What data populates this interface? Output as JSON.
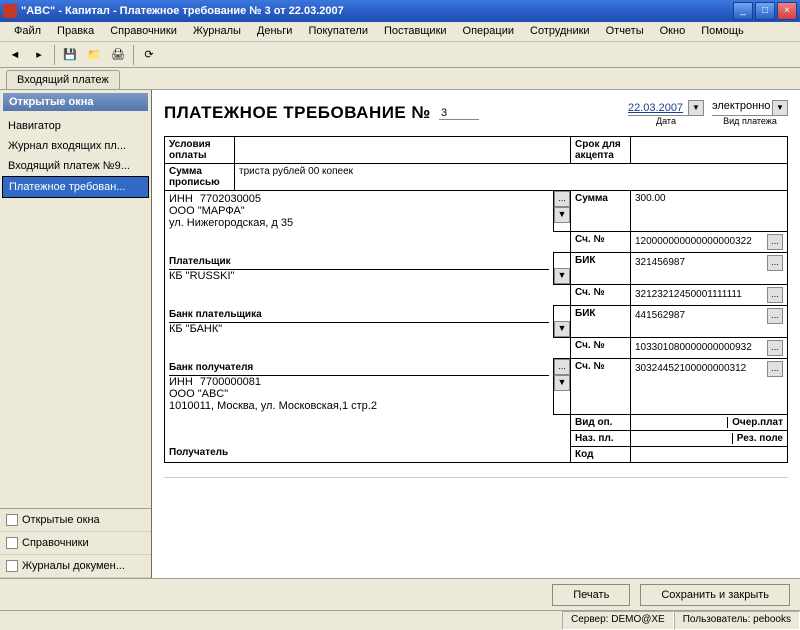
{
  "window": {
    "title": "\"ABC\" - Капитал - Платежное требование № 3 от 22.03.2007"
  },
  "menu": [
    "Файл",
    "Правка",
    "Справочники",
    "Журналы",
    "Деньги",
    "Покупатели",
    "Поставщики",
    "Операции",
    "Сотрудники",
    "Отчеты",
    "Окно",
    "Помощь"
  ],
  "tab": "Входящий платеж",
  "sidebar": {
    "header": "Открытые окна",
    "items": [
      "Навигатор",
      "Журнал входящих пл...",
      "Входящий платеж №9...",
      "Платежное требован..."
    ],
    "btns": [
      "Открытые окна",
      "Справочники",
      "Журналы докумен..."
    ]
  },
  "doc": {
    "title": "ПЛАТЕЖНОЕ ТРЕБОВАНИЕ №",
    "num": "3",
    "date": "22.03.2007",
    "datelbl": "Дата",
    "paytype": "электронно",
    "paytypelbl": "Вид платежа",
    "cond_lbl": "Условия оплаты",
    "accept_lbl": "Срок для акцепта",
    "sum_words_lbl": "Сумма прописью",
    "sum_words": "триста рублей 00 копеек",
    "inn1_lbl": "ИНН",
    "inn1": "7702030005",
    "org1": "ООО \"МАРФА\"",
    "addr1": "ул. Нижегородская, д 35",
    "sum_lbl": "Сумма",
    "sum": "300.00",
    "sch_lbl": "Сч. №",
    "sch1": "120000000000000000322",
    "payer_lbl": "Плательщик",
    "kb1": "КБ \"RUSSKI\"",
    "bik_lbl": "БИК",
    "bik1": "321456987",
    "sch2": "32123212450001111111",
    "bank_payer_lbl": "Банк плательщика",
    "kb2": "КБ \"БАНК\"",
    "bik2": "441562987",
    "sch3": "103301080000000000932",
    "bank_recv_lbl": "Банк получателя",
    "inn2_lbl": "ИНН",
    "inn2": "7700000081",
    "org2": "ООО \"ABC\"",
    "addr2": "1010011, Москва, ул. Московская,1 стр.2",
    "sch4": "30324452100000000312",
    "vid_lbl": "Вид оп.",
    "naz_lbl": "Наз. пл.",
    "kod_lbl": "Код",
    "ocher_lbl": "Очер.плат",
    "rez_lbl": "Рез. поле",
    "recv_lbl": "Получатель"
  },
  "buttons": {
    "print": "Печать",
    "save": "Сохранить и закрыть"
  },
  "status": {
    "server": "Сервер: DEMO@XE",
    "user": "Пользователь: pebooks"
  }
}
